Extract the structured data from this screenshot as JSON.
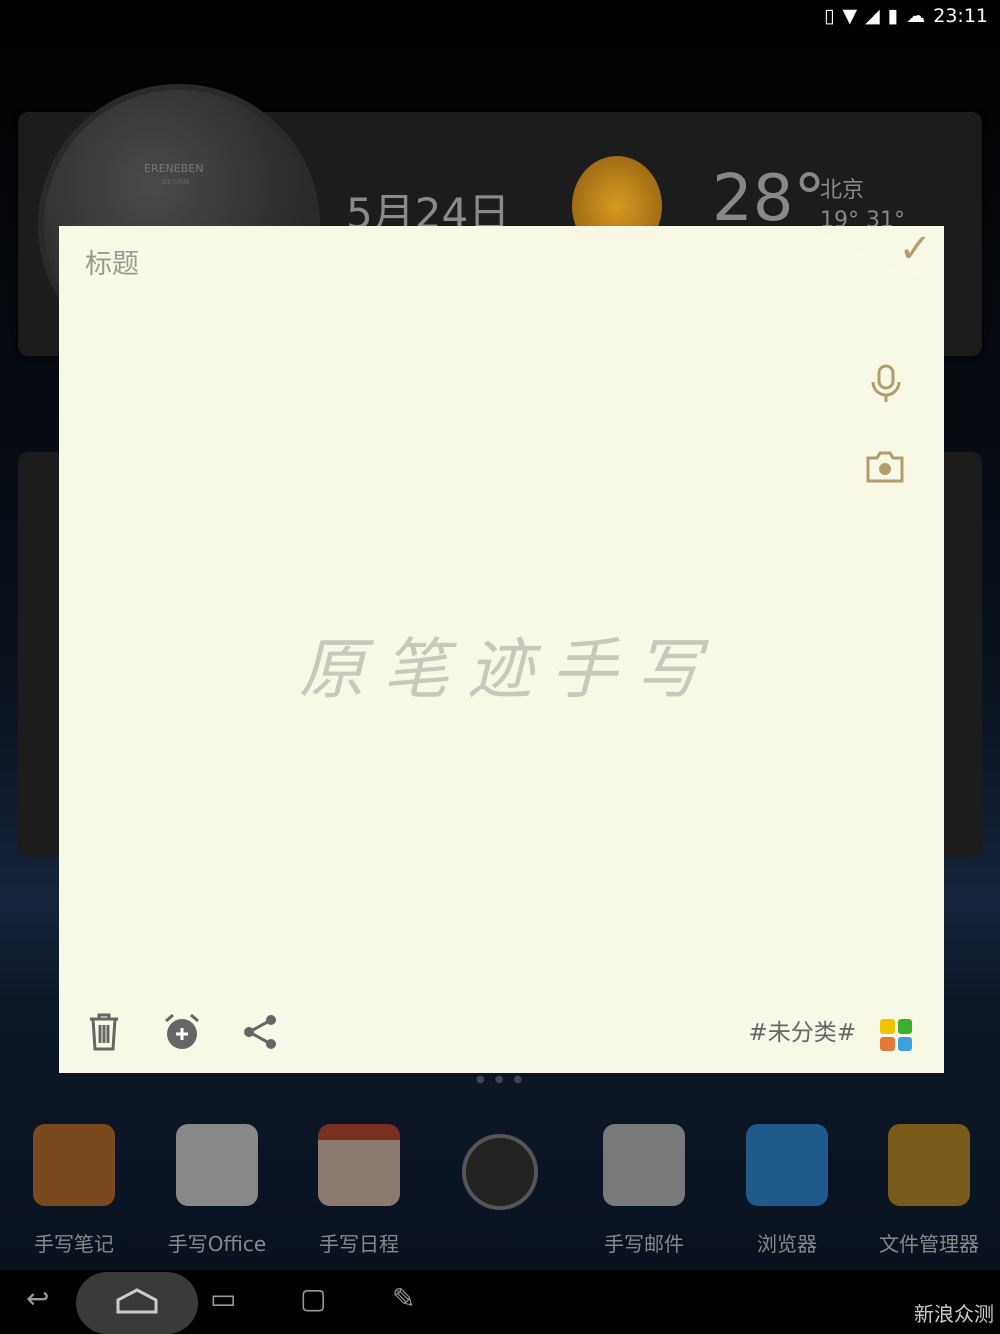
{
  "status": {
    "time": "23:11",
    "icons": [
      "vibrate-icon",
      "wifi-icon",
      "signal-icon",
      "battery-icon",
      "cloud-icon"
    ]
  },
  "widget": {
    "brand": "ERENEBEN",
    "brand_sub": "DESIGN",
    "date": "5月24日",
    "temperature": "28°",
    "city": "北京",
    "range": "19° 31°"
  },
  "note": {
    "title_placeholder": "标题",
    "handwriting": "原笔迹手写",
    "tag": "#未分类#",
    "confirm": "✓",
    "colors": [
      "#f0c400",
      "#3fae2a",
      "#e5793a",
      "#3aa0e0"
    ]
  },
  "dock": {
    "apps": [
      {
        "label": "手写笔记",
        "color": "#7a4a1e"
      },
      {
        "label": "手写Office",
        "color": "#888"
      },
      {
        "label": "手写日程",
        "color": "#8a3a2a"
      },
      {
        "label": "",
        "color": "#222"
      },
      {
        "label": "手写邮件",
        "color": "#7a7a7a"
      },
      {
        "label": "浏览器",
        "color": "#1f5a8a"
      },
      {
        "label": "文件管理器",
        "color": "#7a5a1a"
      }
    ]
  },
  "watermark": "新浪众测"
}
